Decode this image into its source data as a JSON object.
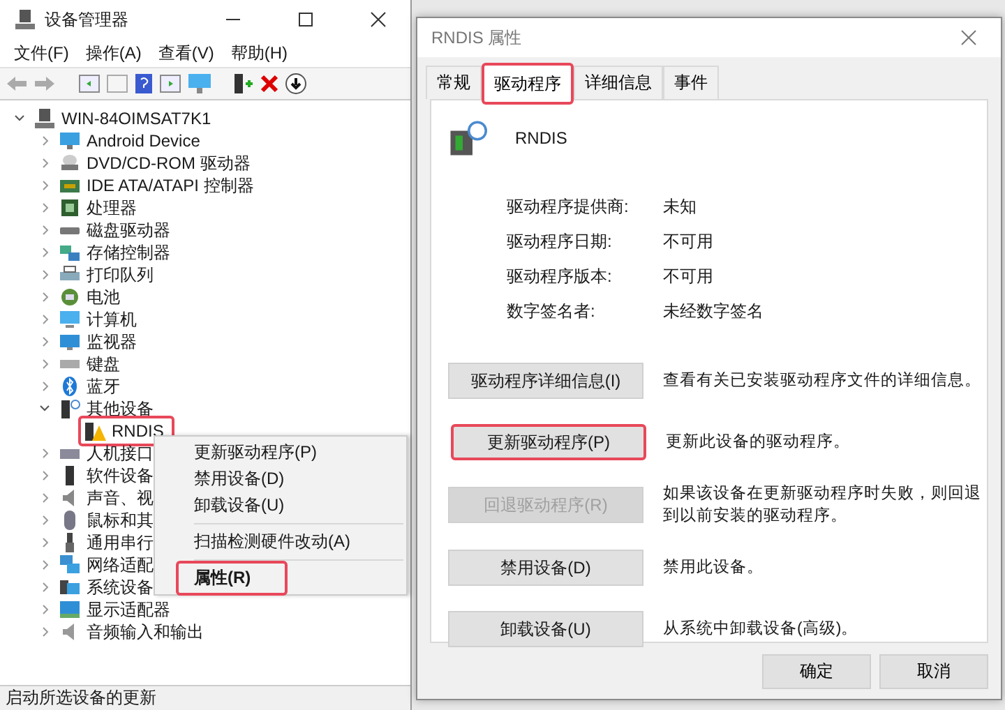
{
  "device_manager": {
    "title": "设备管理器",
    "menu": [
      "文件(F)",
      "操作(A)",
      "查看(V)",
      "帮助(H)"
    ],
    "tree": {
      "label": "WIN-84OIMSAT7K1",
      "expanded": true,
      "children": [
        {
          "label": "Android Device",
          "expanded": false
        },
        {
          "label": "DVD/CD-ROM 驱动器",
          "expanded": false
        },
        {
          "label": "IDE ATA/ATAPI 控制器",
          "expanded": false
        },
        {
          "label": "处理器",
          "expanded": false
        },
        {
          "label": "磁盘驱动器",
          "expanded": false
        },
        {
          "label": "存储控制器",
          "expanded": false
        },
        {
          "label": "打印队列",
          "expanded": false
        },
        {
          "label": "电池",
          "expanded": false
        },
        {
          "label": "计算机",
          "expanded": false
        },
        {
          "label": "监视器",
          "expanded": false
        },
        {
          "label": "键盘",
          "expanded": false
        },
        {
          "label": "蓝牙",
          "expanded": false
        },
        {
          "label": "其他设备",
          "expanded": true,
          "children": [
            {
              "label": "RNDIS",
              "highlighted": true
            }
          ]
        },
        {
          "label": "人机接口",
          "expanded": false
        },
        {
          "label": "软件设备",
          "expanded": false
        },
        {
          "label": "声音、视",
          "expanded": false
        },
        {
          "label": "鼠标和其",
          "expanded": false
        },
        {
          "label": "通用串行",
          "expanded": false
        },
        {
          "label": "网络适配",
          "expanded": false
        },
        {
          "label": "系统设备",
          "expanded": false
        },
        {
          "label": "显示适配器",
          "expanded": false
        },
        {
          "label": "音频输入和输出",
          "expanded": false
        }
      ]
    },
    "context_menu": [
      [
        {
          "label": "更新驱动程序(P)",
          "default": false,
          "highlighted": false
        },
        {
          "label": "禁用设备(D)",
          "default": false,
          "highlighted": false
        },
        {
          "label": "卸载设备(U)",
          "default": false,
          "highlighted": false
        }
      ],
      [
        {
          "label": "扫描检测硬件改动(A)",
          "default": false,
          "highlighted": false
        }
      ],
      [
        {
          "label": "属性(R)",
          "default": true,
          "highlighted": true
        }
      ]
    ],
    "status_bar": "启动所选设备的更新"
  },
  "properties": {
    "title": "RNDIS 属性",
    "tabs": [
      {
        "label": "常规",
        "selected": false
      },
      {
        "label": "驱动程序",
        "selected": true
      },
      {
        "label": "详细信息",
        "selected": false
      },
      {
        "label": "事件",
        "selected": false
      }
    ],
    "device_name": "RNDIS",
    "info": [
      {
        "label": "驱动程序提供商:",
        "value": "未知"
      },
      {
        "label": "驱动程序日期:",
        "value": "不可用"
      },
      {
        "label": "驱动程序版本:",
        "value": "不可用"
      },
      {
        "label": "数字签名者:",
        "value": "未经数字签名"
      }
    ],
    "actions": [
      {
        "button": "驱动程序详细信息(I)",
        "description": "查看有关已安装驱动程序文件的详细信息。",
        "disabled": false,
        "highlighted": false
      },
      {
        "button": "更新驱动程序(P)",
        "description": "更新此设备的驱动程序。",
        "disabled": false,
        "highlighted": true
      },
      {
        "button": "回退驱动程序(R)",
        "description": "如果该设备在更新驱动程序时失败，则回退到以前安装的驱动程序。",
        "disabled": true,
        "highlighted": false
      },
      {
        "button": "禁用设备(D)",
        "description": "禁用此设备。",
        "disabled": false,
        "highlighted": false
      },
      {
        "button": "卸载设备(U)",
        "description": "从系统中卸载设备(高级)。",
        "disabled": false,
        "highlighted": false
      }
    ],
    "buttons": [
      "确定",
      "取消"
    ]
  }
}
